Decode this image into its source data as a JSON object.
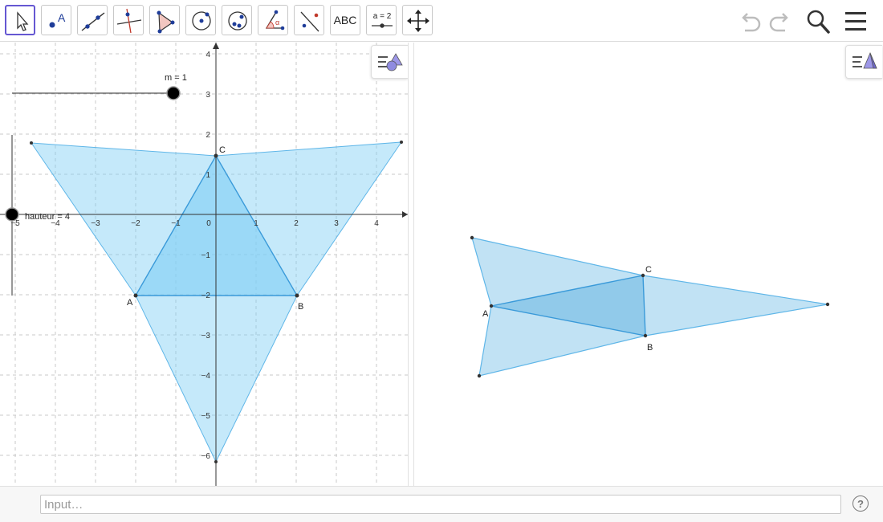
{
  "toolbar": {
    "tools": [
      {
        "name": "move-tool",
        "label": ""
      },
      {
        "name": "point-tool",
        "label": "A"
      },
      {
        "name": "line-tool",
        "label": ""
      },
      {
        "name": "perpendicular-tool",
        "label": ""
      },
      {
        "name": "polygon-tool",
        "label": ""
      },
      {
        "name": "circle-tool",
        "label": ""
      },
      {
        "name": "ellipse-tool",
        "label": ""
      },
      {
        "name": "angle-tool",
        "label": "α"
      },
      {
        "name": "reflect-tool",
        "label": ""
      },
      {
        "name": "text-tool",
        "label": "ABC"
      },
      {
        "name": "slider-tool",
        "label": "a = 2"
      },
      {
        "name": "move-graphics-tool",
        "label": ""
      }
    ],
    "right_icons": [
      "undo-icon",
      "redo-icon",
      "search-icon",
      "menu-icon"
    ]
  },
  "graphics1": {
    "x_ticks": [
      "−5",
      "−4",
      "−3",
      "−2",
      "−1",
      "0",
      "1",
      "2",
      "3",
      "4"
    ],
    "y_ticks": [
      "4",
      "3",
      "2",
      "1",
      "−1",
      "−2",
      "−3",
      "−4",
      "−5",
      "−6"
    ],
    "points": {
      "A": "A",
      "B": "B",
      "C": "C"
    },
    "slider_m": {
      "label": "m = 1",
      "value": 1
    },
    "slider_hauteur": {
      "label": "hauteur = 4",
      "value": 4
    }
  },
  "graphics2": {
    "points": {
      "A": "A",
      "B": "B",
      "C": "C"
    }
  },
  "input_bar": {
    "placeholder": "Input…",
    "help": "?"
  },
  "colors": {
    "accent": "#6557d2",
    "fill": "#7ecff5",
    "stroke": "#5fb6e8",
    "grid": "#c8c8c8"
  }
}
